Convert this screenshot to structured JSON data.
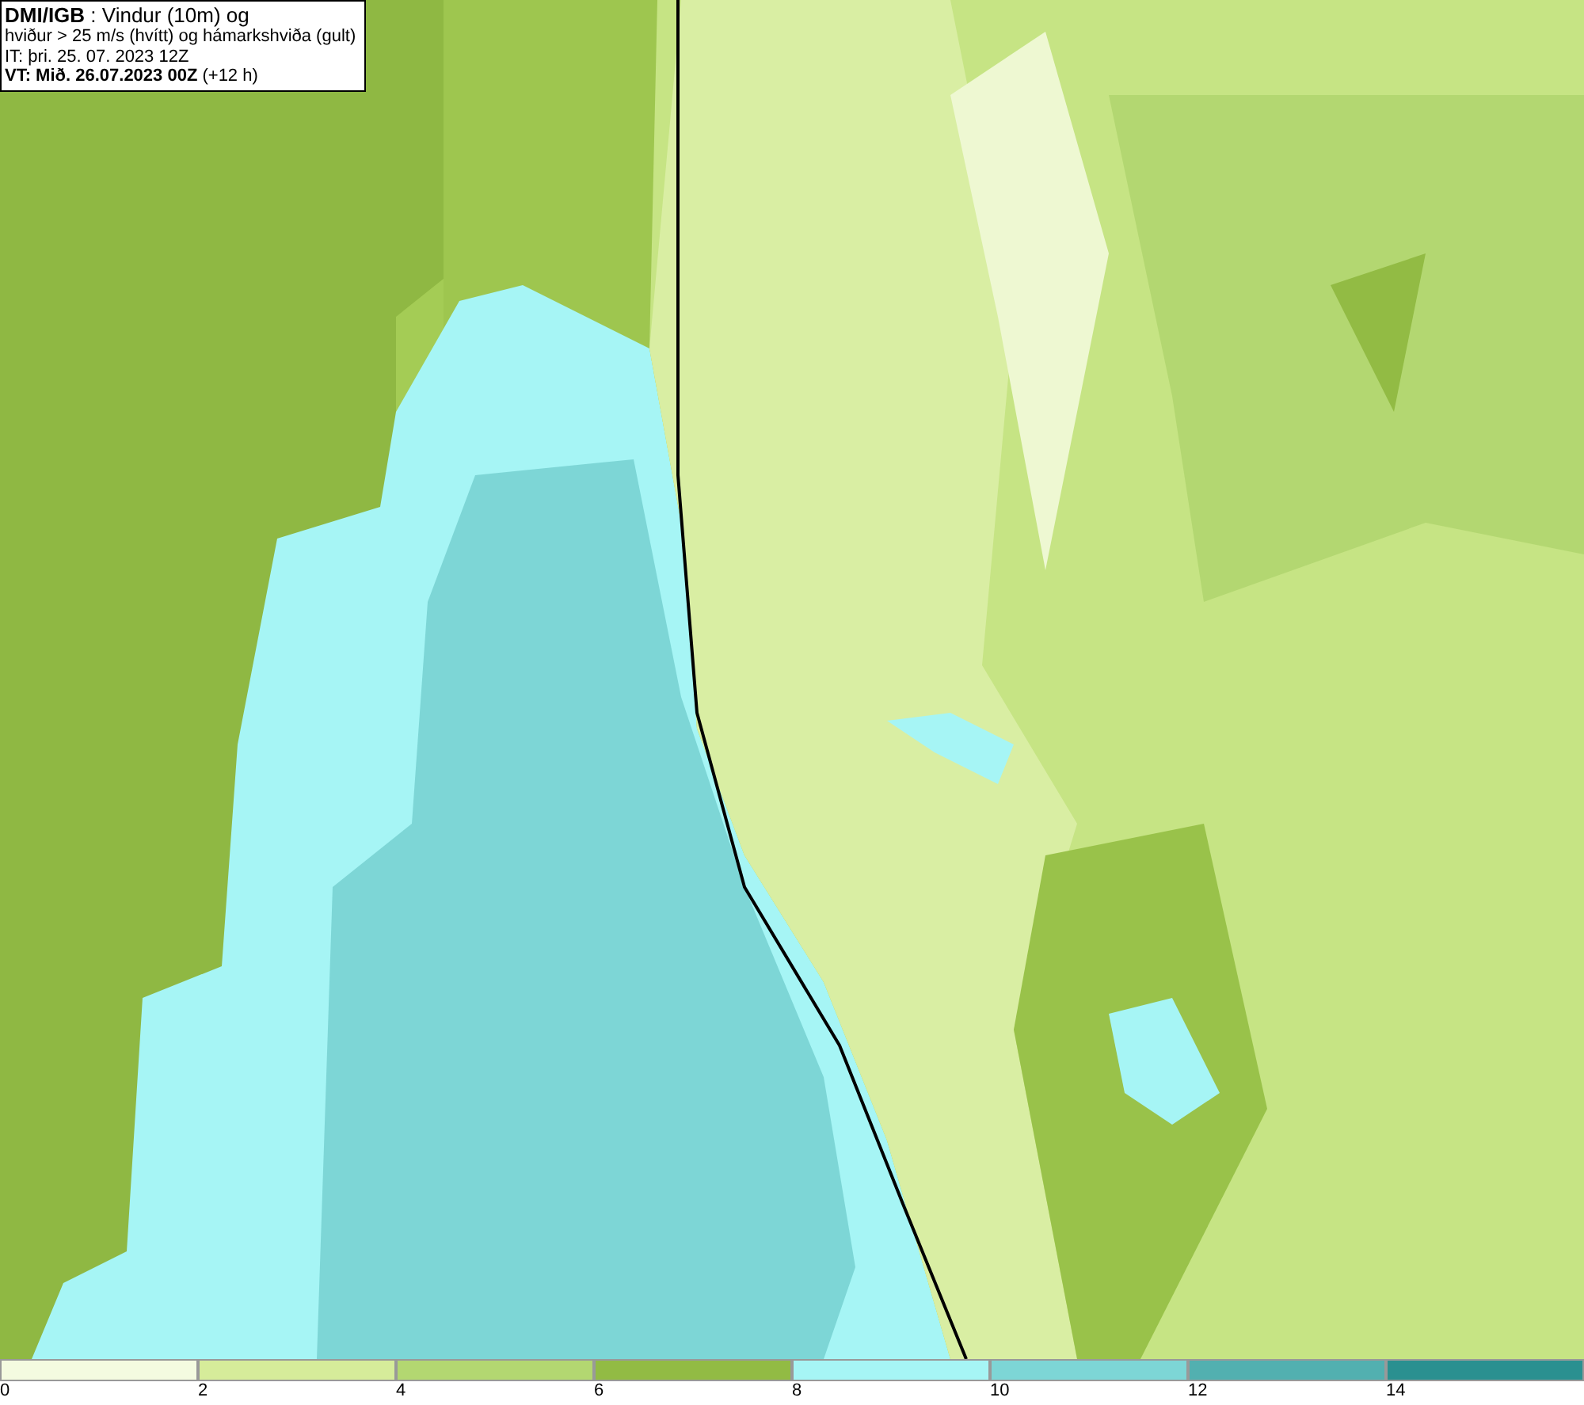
{
  "header": {
    "lines": [
      "**DMI/IGB** : Vindur (10m) og",
      "hviður > 25 m/s (hvítt) og hámarkshviða (gult)",
      "IT: þri. 25. 07. 2023 12Z",
      "**VT: Mið. 26.07.2023 00Z** (+12 h)"
    ]
  },
  "legend": [
    {
      "label": "0",
      "color": "#f4fbe0"
    },
    {
      "label": "2",
      "color": "#d6ec9a"
    },
    {
      "label": "4",
      "color": "#b3d771"
    },
    {
      "label": "6",
      "color": "#92bb44"
    },
    {
      "label": "8",
      "color": "#a6f5f5"
    },
    {
      "label": "10",
      "color": "#7dd6d6"
    },
    {
      "label": "12",
      "color": "#52b0b0"
    },
    {
      "label": "14",
      "color": "#2a9090"
    }
  ]
}
